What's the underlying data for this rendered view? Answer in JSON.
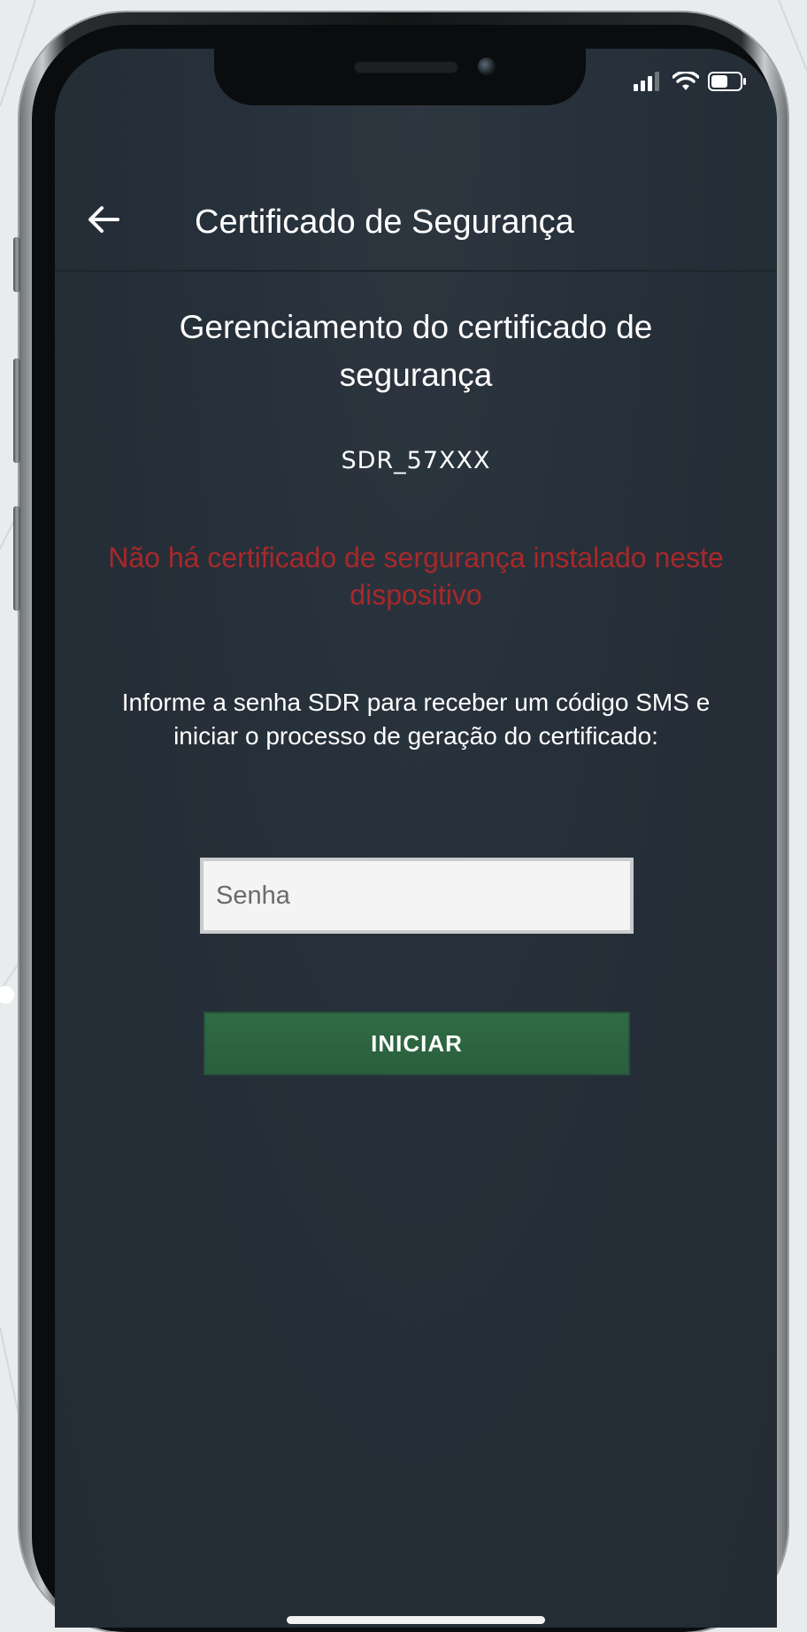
{
  "status_bar": {
    "icons": [
      "signal-icon",
      "wifi-icon",
      "battery-icon"
    ]
  },
  "appbar": {
    "back_icon": "arrow-left-icon",
    "title": "Certificado de Segurança"
  },
  "main": {
    "heading": "Gerenciamento do certificado de segurança",
    "account_id": "SDR_57XXX",
    "warning": "Não há certificado de sergurança instalado neste dispositivo",
    "instructions": "Informe a senha SDR para receber um código SMS e iniciar o processo de geração do certificado:",
    "password_placeholder": "Senha",
    "password_value": "",
    "start_button_label": "INICIAR"
  },
  "colors": {
    "background": "#26303a",
    "warning": "#a8282a",
    "button": "#2f6b44",
    "text": "#ffffff"
  }
}
